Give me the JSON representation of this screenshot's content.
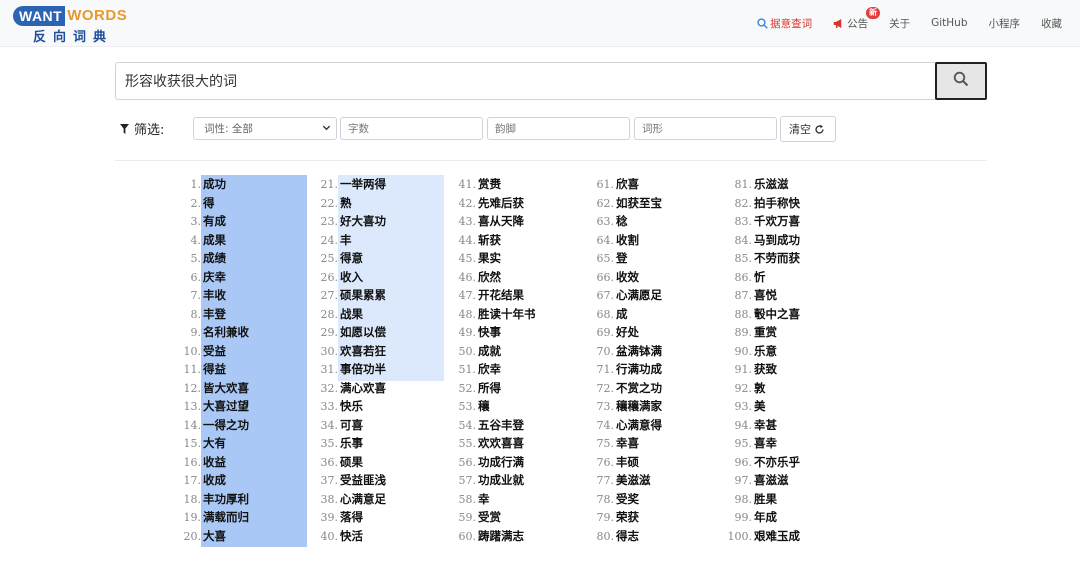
{
  "brand": {
    "en_left": "WANT",
    "en_right": "WORDS",
    "cn": "反向词典"
  },
  "nav": [
    {
      "label": "据意查词",
      "icon": "search-icon",
      "active": true
    },
    {
      "label": "公告",
      "icon": "megaphone-icon",
      "badge": "新"
    },
    {
      "label": "关于"
    },
    {
      "label": "GitHub"
    },
    {
      "label": "小程序"
    },
    {
      "label": "收藏"
    }
  ],
  "search": {
    "value": "形容收获很大的词"
  },
  "filter": {
    "label": "筛选:",
    "pos_select": "词性: 全部",
    "chars_placeholder": "字数",
    "rhyme_placeholder": "韵脚",
    "shape_placeholder": "词形",
    "clear_label": "清空"
  },
  "colors": {
    "accent": "#2b64b3",
    "brand_orange": "#e69a2e",
    "active_nav": "#d9342b",
    "highlight_strong": "#a9c8f5",
    "highlight_light": "#dce8fb"
  },
  "results": [
    [
      "1.",
      "成功"
    ],
    [
      "2.",
      "得"
    ],
    [
      "3.",
      "有成"
    ],
    [
      "4.",
      "成果"
    ],
    [
      "5.",
      "成绩"
    ],
    [
      "6.",
      "庆幸"
    ],
    [
      "7.",
      "丰收"
    ],
    [
      "8.",
      "丰登"
    ],
    [
      "9.",
      "名利兼收"
    ],
    [
      "10.",
      "受益"
    ],
    [
      "11.",
      "得益"
    ],
    [
      "12.",
      "皆大欢喜"
    ],
    [
      "13.",
      "大喜过望"
    ],
    [
      "14.",
      "一得之功"
    ],
    [
      "15.",
      "大有"
    ],
    [
      "16.",
      "收益"
    ],
    [
      "17.",
      "收成"
    ],
    [
      "18.",
      "丰功厚利"
    ],
    [
      "19.",
      "满载而归"
    ],
    [
      "20.",
      "大喜"
    ],
    [
      "21.",
      "一举两得"
    ],
    [
      "22.",
      "熟"
    ],
    [
      "23.",
      "好大喜功"
    ],
    [
      "24.",
      "丰"
    ],
    [
      "25.",
      "得意"
    ],
    [
      "26.",
      "收入"
    ],
    [
      "27.",
      "硕果累累"
    ],
    [
      "28.",
      "战果"
    ],
    [
      "29.",
      "如愿以偿"
    ],
    [
      "30.",
      "欢喜若狂"
    ],
    [
      "31.",
      "事倍功半"
    ],
    [
      "32.",
      "满心欢喜"
    ],
    [
      "33.",
      "快乐"
    ],
    [
      "34.",
      "可喜"
    ],
    [
      "35.",
      "乐事"
    ],
    [
      "36.",
      "硕果"
    ],
    [
      "37.",
      "受益匪浅"
    ],
    [
      "38.",
      "心满意足"
    ],
    [
      "39.",
      "落得"
    ],
    [
      "40.",
      "快活"
    ],
    [
      "41.",
      "赏赉"
    ],
    [
      "42.",
      "先难后获"
    ],
    [
      "43.",
      "喜从天降"
    ],
    [
      "44.",
      "斩获"
    ],
    [
      "45.",
      "果实"
    ],
    [
      "46.",
      "欣然"
    ],
    [
      "47.",
      "开花结果"
    ],
    [
      "48.",
      "胜读十年书"
    ],
    [
      "49.",
      "快事"
    ],
    [
      "50.",
      "成就"
    ],
    [
      "51.",
      "欣幸"
    ],
    [
      "52.",
      "所得"
    ],
    [
      "53.",
      "穰"
    ],
    [
      "54.",
      "五谷丰登"
    ],
    [
      "55.",
      "欢欢喜喜"
    ],
    [
      "56.",
      "功成行满"
    ],
    [
      "57.",
      "功成业就"
    ],
    [
      "58.",
      "幸"
    ],
    [
      "59.",
      "受赏"
    ],
    [
      "60.",
      "踌躇满志"
    ],
    [
      "61.",
      "欣喜"
    ],
    [
      "62.",
      "如获至宝"
    ],
    [
      "63.",
      "稔"
    ],
    [
      "64.",
      "收割"
    ],
    [
      "65.",
      "登"
    ],
    [
      "66.",
      "收效"
    ],
    [
      "67.",
      "心满愿足"
    ],
    [
      "68.",
      "成"
    ],
    [
      "69.",
      "好处"
    ],
    [
      "70.",
      "盆满钵满"
    ],
    [
      "71.",
      "行满功成"
    ],
    [
      "72.",
      "不赏之功"
    ],
    [
      "73.",
      "穰穰满家"
    ],
    [
      "74.",
      "心满意得"
    ],
    [
      "75.",
      "幸喜"
    ],
    [
      "76.",
      "丰硕"
    ],
    [
      "77.",
      "美滋滋"
    ],
    [
      "78.",
      "受奖"
    ],
    [
      "79.",
      "荣获"
    ],
    [
      "80.",
      "得志"
    ],
    [
      "81.",
      "乐滋滋"
    ],
    [
      "82.",
      "拍手称快"
    ],
    [
      "83.",
      "千欢万喜"
    ],
    [
      "84.",
      "马到成功"
    ],
    [
      "85.",
      "不劳而获"
    ],
    [
      "86.",
      "忻"
    ],
    [
      "87.",
      "喜悦"
    ],
    [
      "88.",
      "彀中之喜"
    ],
    [
      "89.",
      "重赏"
    ],
    [
      "90.",
      "乐意"
    ],
    [
      "91.",
      "获致"
    ],
    [
      "92.",
      "敦"
    ],
    [
      "93.",
      "美"
    ],
    [
      "94.",
      "幸甚"
    ],
    [
      "95.",
      "喜幸"
    ],
    [
      "96.",
      "不亦乐乎"
    ],
    [
      "97.",
      "喜滋滋"
    ],
    [
      "98.",
      "胜果"
    ],
    [
      "99.",
      "年成"
    ],
    [
      "100.",
      "艰难玉成"
    ]
  ]
}
